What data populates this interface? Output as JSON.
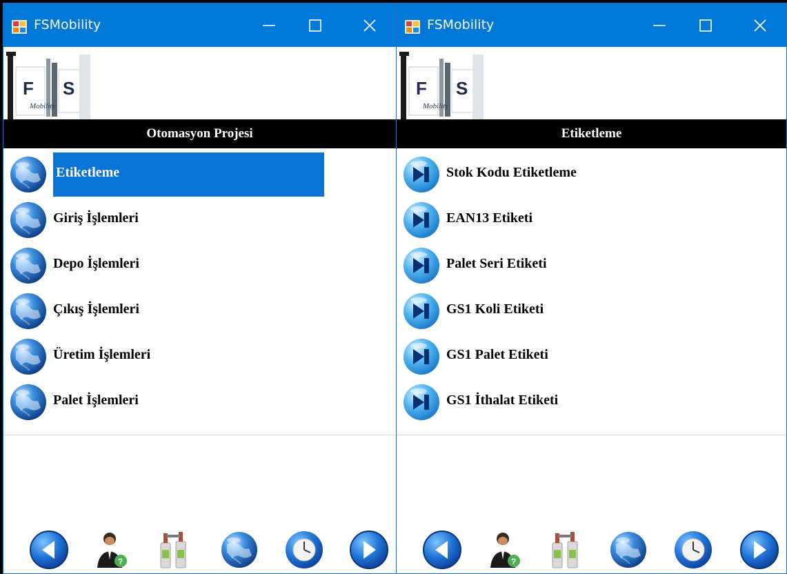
{
  "windows": [
    {
      "title": "FSMobility",
      "logo": {
        "letters": [
          "F",
          "S"
        ],
        "subtitle": "Mobility"
      },
      "section_title": "Otomasyon Projesi",
      "icon_type": "globe",
      "items": [
        {
          "label": "Etiketleme",
          "selected": true
        },
        {
          "label": "Giriş İşlemleri",
          "selected": false
        },
        {
          "label": "Depo İşlemleri",
          "selected": false
        },
        {
          "label": "Çıkış İşlemleri",
          "selected": false
        },
        {
          "label": "Üretim İşlemleri",
          "selected": false
        },
        {
          "label": "Palet İşlemleri",
          "selected": false
        }
      ]
    },
    {
      "title": "FSMobility",
      "logo": {
        "letters": [
          "F",
          "S"
        ],
        "subtitle": "Mobility"
      },
      "section_title": "Etiketleme",
      "icon_type": "skip-forward",
      "items": [
        {
          "label": "Stok Kodu Etiketleme",
          "selected": false
        },
        {
          "label": "EAN13 Etiketi",
          "selected": false
        },
        {
          "label": "Palet Seri Etiketi",
          "selected": false
        },
        {
          "label": "GS1 Koli Etiketi",
          "selected": false
        },
        {
          "label": "GS1 Palet Etiketi",
          "selected": false
        },
        {
          "label": "GS1 İthalat Etiketi",
          "selected": false
        }
      ]
    }
  ],
  "toolbar": [
    "back-arrow-icon",
    "user-help-icon",
    "barcode-scanner-icon",
    "globe-icon",
    "clock-icon",
    "forward-arrow-icon"
  ],
  "colors": {
    "titlebar": "#0078d7",
    "selection": "#0a74d4",
    "section_bar": "#000000",
    "button_blue": "#1565c0"
  }
}
